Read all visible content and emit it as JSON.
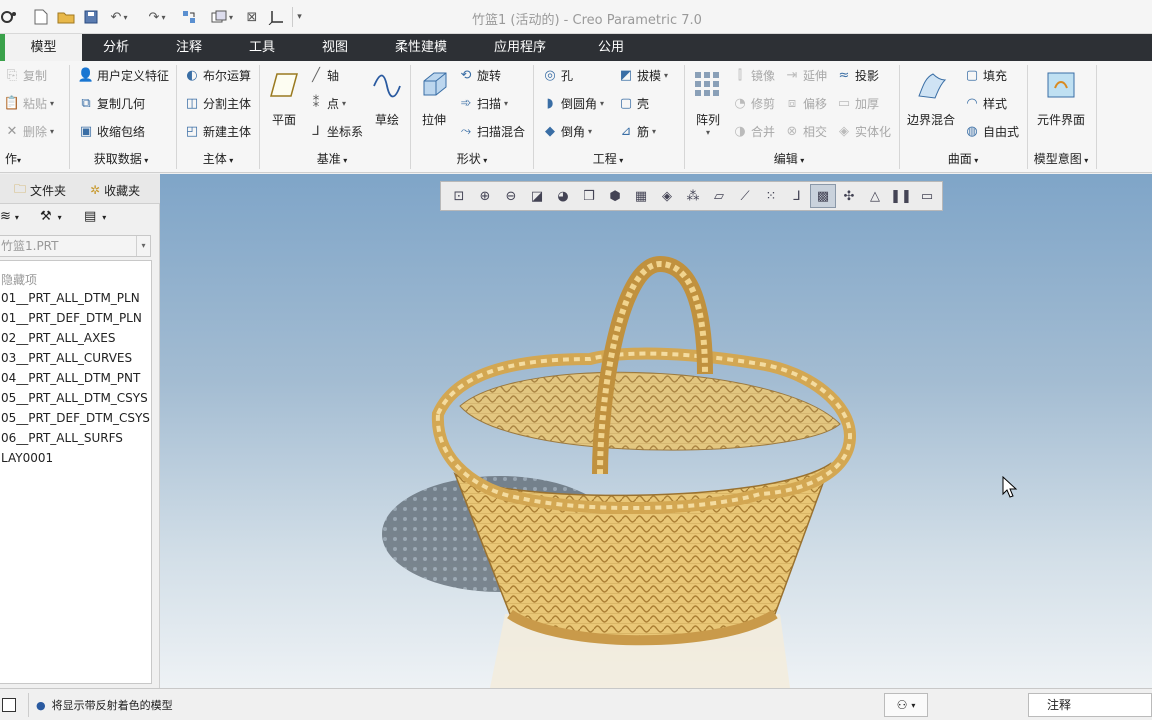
{
  "app": {
    "title": "竹篮1 (活动的) - Creo Parametric 7.0"
  },
  "quick_access": {
    "icons": [
      "creo-logo-icon",
      "new-file-icon",
      "open-folder-icon",
      "save-icon",
      "undo-icon",
      "redo-icon",
      "regenerate-icon",
      "switch-window-icon",
      "close-window-icon",
      "csys-icon",
      "customize-icon"
    ]
  },
  "tabs": [
    {
      "label": "模型",
      "active": true
    },
    {
      "label": "分析"
    },
    {
      "label": "注释"
    },
    {
      "label": "工具"
    },
    {
      "label": "视图"
    },
    {
      "label": "柔性建模"
    },
    {
      "label": "应用程序"
    },
    {
      "label": "公用"
    }
  ],
  "ribbon": {
    "ops": {
      "copy": "复制",
      "paste": "粘贴",
      "delete": "删除",
      "group": "作"
    },
    "getdata": {
      "udf": "用户定义特征",
      "copy_geom": "复制几何",
      "shrinkwrap": "收缩包络",
      "group": "获取数据"
    },
    "body": {
      "boolean": "布尔运算",
      "split": "分割主体",
      "new": "新建主体",
      "group": "主体"
    },
    "datum": {
      "plane": "平面",
      "axis": "轴",
      "point": "点",
      "csys": "坐标系",
      "sketch": "草绘",
      "group": "基准"
    },
    "shapes": {
      "extrude": "拉伸",
      "revolve": "旋转",
      "sweep": "扫描",
      "swept_blend": "扫描混合",
      "group": "形状"
    },
    "engineering": {
      "hole": "孔",
      "round": "倒圆角",
      "chamfer": "倒角",
      "draft": "拔模",
      "shell": "壳",
      "rib": "筋",
      "group": "工程"
    },
    "editing": {
      "pattern": "阵列",
      "mirror": "镜像",
      "trim": "修剪",
      "merge": "合并",
      "extend": "延伸",
      "offset": "偏移",
      "intersect": "相交",
      "project": "投影",
      "thicken": "加厚",
      "solidify": "实体化",
      "group": "编辑"
    },
    "surfaces": {
      "boundary_blend": "边界混合",
      "fill": "填充",
      "style": "样式",
      "freestyle": "自由式",
      "group": "曲面"
    },
    "intent": {
      "component_interface": "元件界面",
      "group": "模型意图"
    }
  },
  "left_panel": {
    "tabs": [
      "文件夹",
      "收藏夹"
    ],
    "model_combo": "竹篮1.PRT",
    "layers": [
      "隐藏项",
      "01__PRT_ALL_DTM_PLN",
      "01__PRT_DEF_DTM_PLN",
      "02__PRT_ALL_AXES",
      "03__PRT_ALL_CURVES",
      "04__PRT_ALL_DTM_PNT",
      "05__PRT_ALL_DTM_CSYS",
      "05__PRT_DEF_DTM_CSYS",
      "06__PRT_ALL_SURFS",
      "LAY0001"
    ]
  },
  "graphics_toolbar": {
    "icons": [
      "refit-icon",
      "zoom-in-icon",
      "zoom-out-icon",
      "repaint-icon",
      "display-style-icon",
      "saved-orientations-icon",
      "view-manager-icon",
      "section-icon",
      "appearance-icon",
      "datum-display-icon",
      "plane-display-icon",
      "axis-display-icon",
      "point-display-icon",
      "csys-display-icon",
      "annotation-display-icon",
      "shade-reflection-icon",
      "spin-center-icon",
      "realtime-render-icon",
      "pause-icon",
      "hide-toolbar-icon"
    ],
    "active": "shade-reflection-icon"
  },
  "status": {
    "message": "将显示带反射着色的模型",
    "filter": "注释"
  },
  "colors": {
    "tab_bar": "#2d3035",
    "active_tab_marker": "#3aa14a",
    "accent": "#3a6ea5",
    "basket": "#e8c578"
  }
}
